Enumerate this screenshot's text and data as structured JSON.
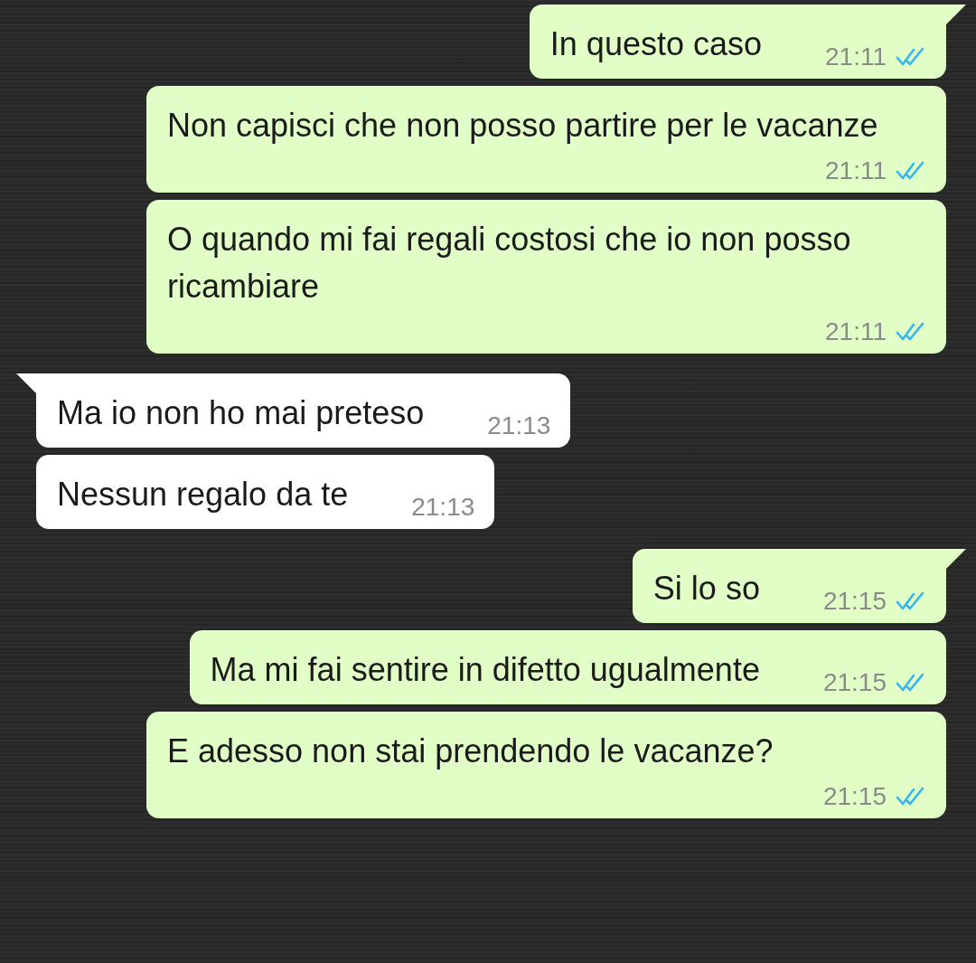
{
  "messages": [
    {
      "kind": "outgoing",
      "tail": true,
      "text": "In questo caso",
      "time": "21:11",
      "read": true
    },
    {
      "kind": "outgoing",
      "tail": false,
      "text": "Non capisci che non posso partire per le vacanze",
      "time": "21:11",
      "read": true
    },
    {
      "kind": "outgoing",
      "tail": false,
      "text": "O quando mi fai regali costosi che io non posso ricambiare",
      "time": "21:11",
      "read": true
    },
    {
      "kind": "incoming",
      "tail": true,
      "text": "Ma io non ho mai preteso",
      "time": "21:13"
    },
    {
      "kind": "incoming",
      "tail": false,
      "text": "Nessun regalo da te",
      "time": "21:13"
    },
    {
      "kind": "outgoing",
      "tail": true,
      "text": "Si lo so",
      "time": "21:15",
      "read": true
    },
    {
      "kind": "outgoing",
      "tail": false,
      "text": "Ma mi fai sentire in difetto ugualmente",
      "time": "21:15",
      "read": true
    },
    {
      "kind": "outgoing",
      "tail": false,
      "text": "E adesso non stai prendendo le vacanze?",
      "time": "21:15",
      "read": true
    }
  ]
}
